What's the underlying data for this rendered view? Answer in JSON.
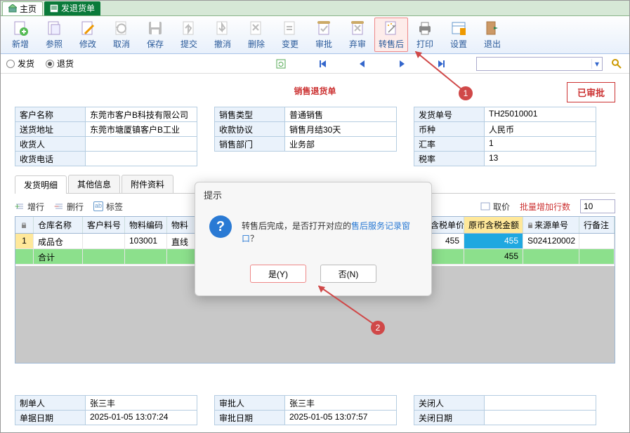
{
  "tabs": {
    "home": "主页",
    "current": "发退货单"
  },
  "toolbar": [
    {
      "id": "new",
      "label": "新增"
    },
    {
      "id": "ref",
      "label": "参照"
    },
    {
      "id": "edit",
      "label": "修改"
    },
    {
      "id": "cancel",
      "label": "取消"
    },
    {
      "id": "save",
      "label": "保存"
    },
    {
      "id": "submit",
      "label": "提交"
    },
    {
      "id": "revoke",
      "label": "撤消"
    },
    {
      "id": "delete",
      "label": "删除"
    },
    {
      "id": "change",
      "label": "变更"
    },
    {
      "id": "approve",
      "label": "审批"
    },
    {
      "id": "abandon",
      "label": "弃审"
    },
    {
      "id": "aftersale",
      "label": "转售后"
    },
    {
      "id": "print",
      "label": "打印"
    },
    {
      "id": "settings",
      "label": "设置"
    },
    {
      "id": "exit",
      "label": "退出"
    }
  ],
  "radios": {
    "ship": "发货",
    "return": "退货",
    "selected": "return"
  },
  "doc_title": "销售退货单",
  "approved": "已审批",
  "form_left": [
    {
      "label": "客户名称",
      "value": "东莞市客户B科技有限公司"
    },
    {
      "label": "送货地址",
      "value": "东莞市塘厦镇客户B工业"
    },
    {
      "label": "收货人",
      "value": ""
    },
    {
      "label": "收货电话",
      "value": ""
    }
  ],
  "form_mid": [
    {
      "label": "销售类型",
      "value": "普通销售"
    },
    {
      "label": "收款协议",
      "value": "销售月结30天"
    },
    {
      "label": "销售部门",
      "value": "业务部"
    }
  ],
  "form_right": [
    {
      "label": "发货单号",
      "value": "TH25010001"
    },
    {
      "label": "币种",
      "value": "人民币"
    },
    {
      "label": "汇率",
      "value": "1"
    },
    {
      "label": "税率",
      "value": "13"
    }
  ],
  "detail_tabs": [
    "发货明细",
    "其他信息",
    "附件资料"
  ],
  "grid_toolbar": {
    "add_row": "增行",
    "del_row": "删行",
    "tag": "标签",
    "get_price": "取价",
    "batch_label": "批量增加行数",
    "batch_value": "10"
  },
  "grid_headers": {
    "warehouse": "仓库名称",
    "custmat": "客户料号",
    "matcode": "物料编码",
    "matname": "物料",
    "unitprice": "含税单价",
    "amount": "原币含税金额",
    "srcdoc": "来源单号",
    "remark": "行备注"
  },
  "grid_rows": [
    {
      "warehouse": "成品仓",
      "custmat": "",
      "matcode": "103001",
      "matname": "直线",
      "unitprice": "455",
      "amount": "455",
      "srcdoc": "S024120002",
      "remark": ""
    }
  ],
  "grid_total": {
    "label": "合计",
    "amount": "455"
  },
  "footer": {
    "creator_label": "制单人",
    "creator": "张三丰",
    "create_date_label": "单据日期",
    "create_date": "2025-01-05 13:07:24",
    "approver_label": "审批人",
    "approver": "张三丰",
    "approve_date_label": "审批日期",
    "approve_date": "2025-01-05 13:07:57",
    "closer_label": "关闭人",
    "closer": "",
    "close_date_label": "关闭日期",
    "close_date": ""
  },
  "dialog": {
    "title": "提示",
    "msg_plain": "转售后完成，是否打开对应的",
    "msg_link": "售后服务记录窗口",
    "msg_tail": "？",
    "yes": "是(Y)",
    "no": "否(N)"
  },
  "annotations": {
    "1": "1",
    "2": "2"
  }
}
